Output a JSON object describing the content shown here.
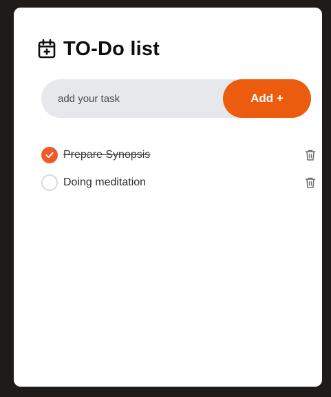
{
  "app": {
    "title": "TO-Do list",
    "accent_color": "#ec5c0e",
    "title_icon": "calendar-plus-icon"
  },
  "input": {
    "placeholder": "add your task",
    "value": ""
  },
  "add_button": {
    "label": "Add +"
  },
  "tasks": [
    {
      "label": "Prepare Synopsis",
      "done": true,
      "check_icon": "check-icon",
      "delete_icon": "trash-icon"
    },
    {
      "label": "Doing meditation",
      "done": false,
      "check_icon": "circle-icon",
      "delete_icon": "trash-icon"
    }
  ]
}
